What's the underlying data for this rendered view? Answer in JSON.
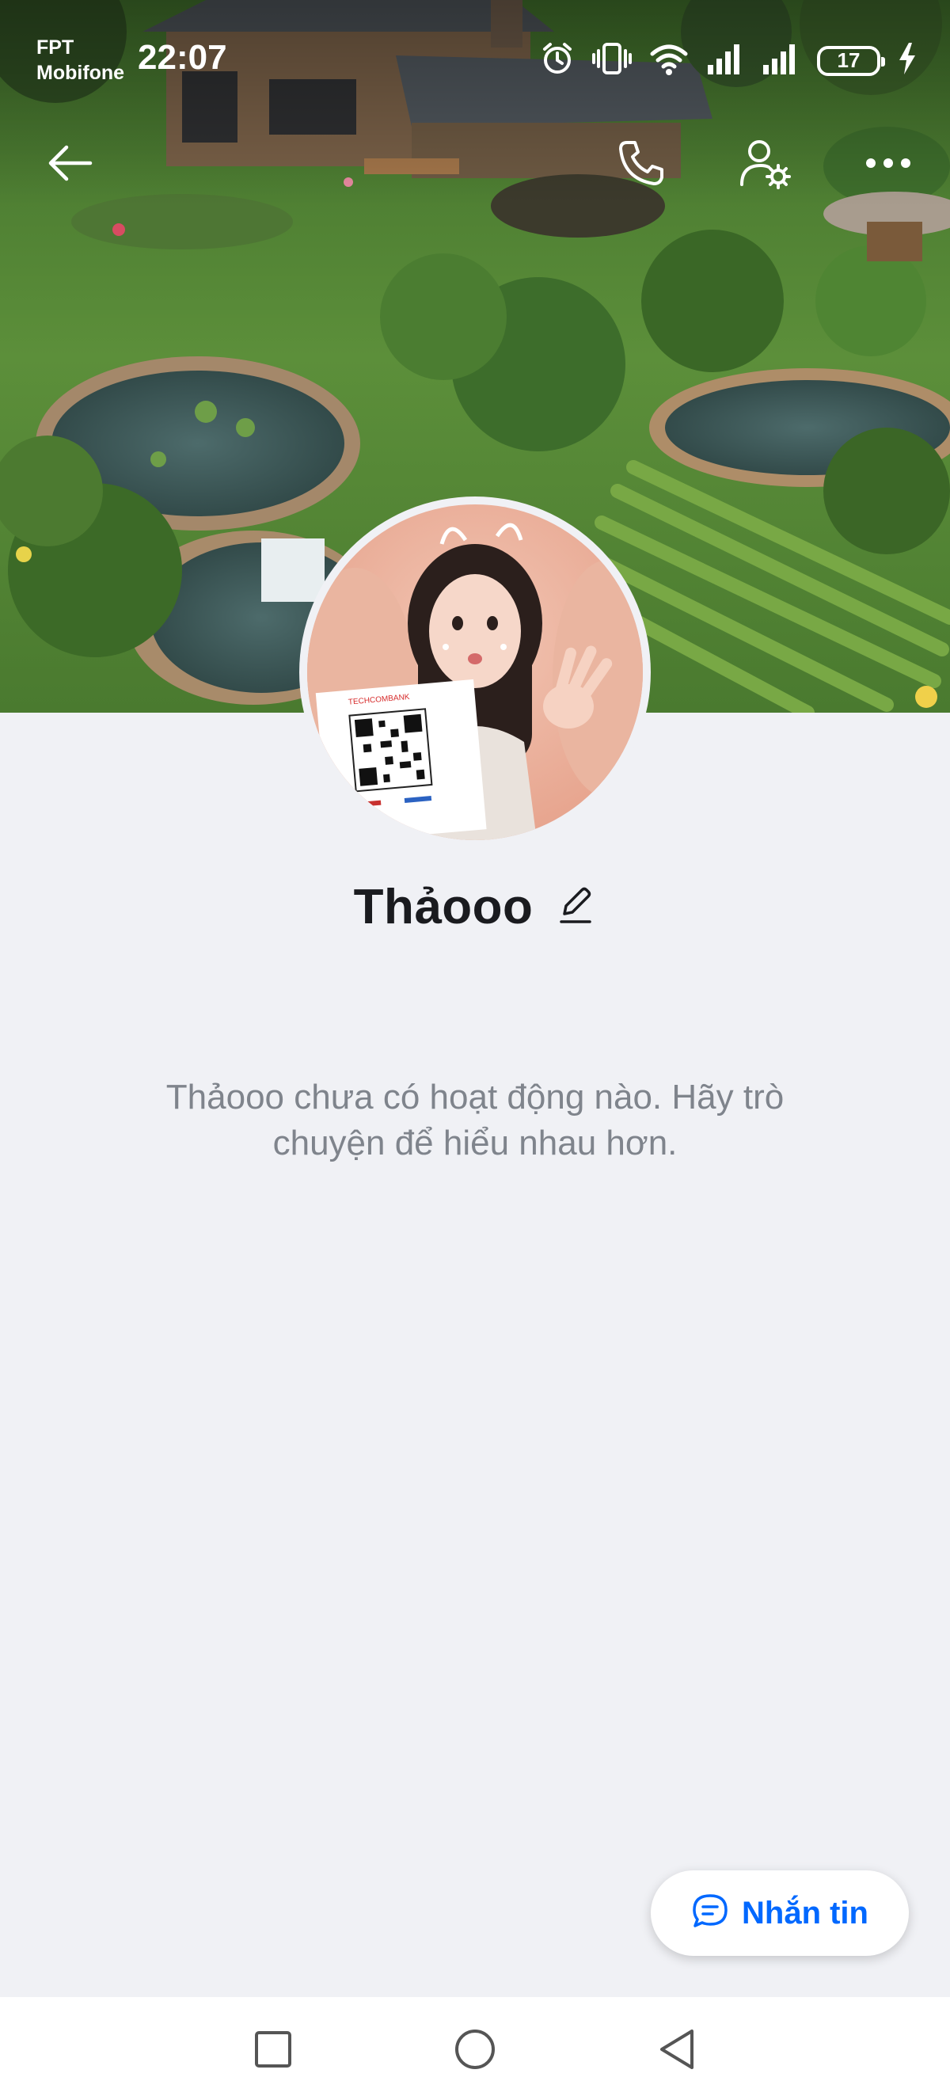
{
  "status_bar": {
    "carrier_line1": "FPT",
    "carrier_line2": "Mobifone",
    "time": "22:07",
    "battery_level": "17",
    "icons": [
      "alarm-icon",
      "vibrate-icon",
      "wifi-icon",
      "signal-icon",
      "signal-icon",
      "battery-icon",
      "charging-icon"
    ]
  },
  "header": {
    "icons": [
      "back-arrow-icon",
      "phone-icon",
      "user-settings-icon",
      "more-icon"
    ]
  },
  "profile": {
    "name": "Thảooo",
    "empty_message": "Thảooo chưa có hoạt động nào. Hãy trò chuyện để hiểu nhau hơn.",
    "avatar_card_text": "TECHCOMBANK"
  },
  "actions": {
    "message_label": "Nhắn tin"
  },
  "navigation": {
    "icons": [
      "recent-apps-icon",
      "home-icon",
      "back-icon"
    ]
  },
  "colors": {
    "accent": "#0068ff",
    "background": "#f0f1f5",
    "text_primary": "#1a1b1f",
    "text_secondary": "#7f848c"
  }
}
